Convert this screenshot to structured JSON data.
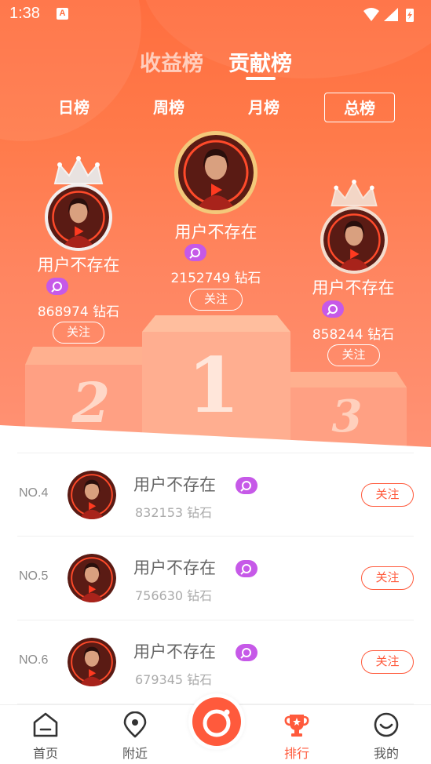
{
  "status_bar": {
    "time": "1:38",
    "app_badge": "A"
  },
  "main_tabs": [
    {
      "label": "收益榜",
      "active": false
    },
    {
      "label": "贡献榜",
      "active": true
    }
  ],
  "sub_tabs": [
    {
      "label": "日榜",
      "active": false
    },
    {
      "label": "周榜",
      "active": false
    },
    {
      "label": "月榜",
      "active": false
    },
    {
      "label": "总榜",
      "active": true
    }
  ],
  "podium": {
    "first": {
      "name": "用户不存在",
      "diamonds": "2152749 钻石",
      "follow": "关注",
      "rank_numeral": "1"
    },
    "second": {
      "name": "用户不存在",
      "diamonds": "868974 钻石",
      "follow": "关注",
      "rank_numeral": "2"
    },
    "third": {
      "name": "用户不存在",
      "diamonds": "858244 钻石",
      "follow": "关注",
      "rank_numeral": "3"
    }
  },
  "ranking_list": [
    {
      "rank": "NO.4",
      "name": "用户不存在",
      "diamonds": "832153 钻石",
      "follow": "关注"
    },
    {
      "rank": "NO.5",
      "name": "用户不存在",
      "diamonds": "756630 钻石",
      "follow": "关注"
    },
    {
      "rank": "NO.6",
      "name": "用户不存在",
      "diamonds": "679345 钻石",
      "follow": "关注"
    }
  ],
  "bottom_nav": [
    {
      "label": "首页",
      "icon": "home-icon",
      "active": false
    },
    {
      "label": "附近",
      "icon": "location-pin-icon",
      "active": false
    },
    {
      "label": "排行",
      "icon": "trophy-icon",
      "active": true
    },
    {
      "label": "我的",
      "icon": "profile-face-icon",
      "active": false
    }
  ],
  "colors": {
    "accent": "#ff5a3c",
    "gradient_top": "#ff6e3f",
    "badge": "#c659e8"
  }
}
